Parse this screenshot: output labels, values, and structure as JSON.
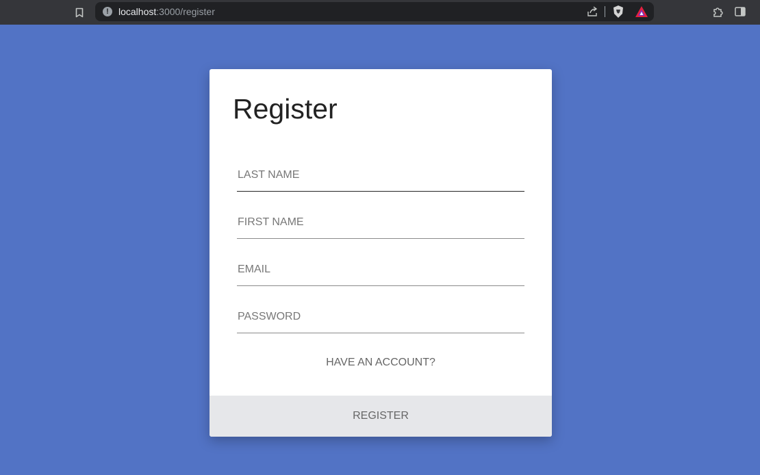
{
  "browser": {
    "url_host": "localhost",
    "url_rest": ":3000/register",
    "icons": [
      "bookmark-icon",
      "site-info-icon",
      "share-icon",
      "brave-shield-icon",
      "brave-rewards-icon",
      "extensions-icon",
      "sidebar-icon"
    ]
  },
  "form": {
    "title": "Register",
    "fields": [
      {
        "placeholder": "LAST NAME",
        "value": ""
      },
      {
        "placeholder": "FIRST NAME",
        "value": ""
      },
      {
        "placeholder": "EMAIL",
        "value": ""
      },
      {
        "placeholder": "PASSWORD",
        "value": ""
      }
    ],
    "have_account_label": "HAVE AN ACCOUNT?",
    "submit_label": "REGISTER"
  },
  "colors": {
    "page_background": "#5273c5",
    "card_background": "#ffffff",
    "button_background": "#e6e7ea",
    "browser_chrome": "#35363a"
  }
}
